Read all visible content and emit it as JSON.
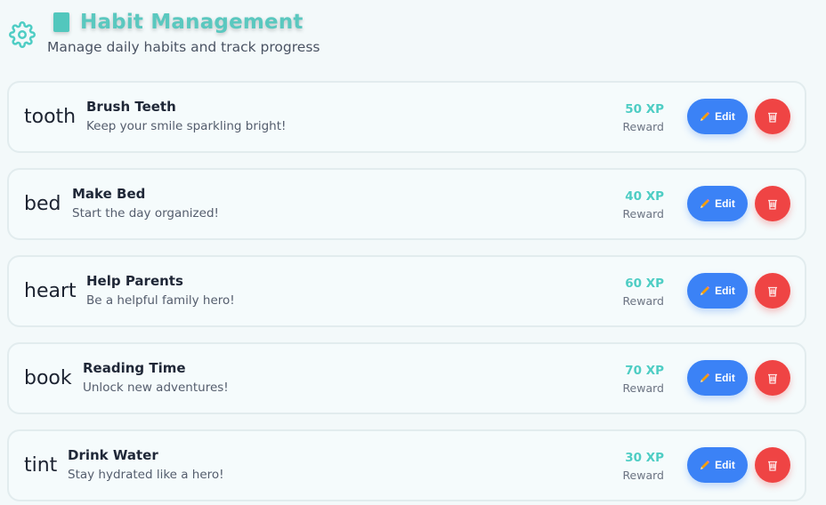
{
  "header": {
    "title": "Habit Management",
    "subtitle": "Manage daily habits and track progress",
    "settings_icon": "gear-icon",
    "title_icon": "clipboard-icon"
  },
  "colors": {
    "accent": "#4ecdc4",
    "edit": "#3b82f6",
    "delete": "#ef4444"
  },
  "habits": [
    {
      "icon": "tooth",
      "name": "Brush Teeth",
      "desc": "Keep your smile sparkling bright!",
      "xp": "50 XP",
      "xp_label": "Reward",
      "edit_label": "Edit"
    },
    {
      "icon": "bed",
      "name": "Make Bed",
      "desc": "Start the day organized!",
      "xp": "40 XP",
      "xp_label": "Reward",
      "edit_label": "Edit"
    },
    {
      "icon": "heart",
      "name": "Help Parents",
      "desc": "Be a helpful family hero!",
      "xp": "60 XP",
      "xp_label": "Reward",
      "edit_label": "Edit"
    },
    {
      "icon": "book",
      "name": "Reading Time",
      "desc": "Unlock new adventures!",
      "xp": "70 XP",
      "xp_label": "Reward",
      "edit_label": "Edit"
    },
    {
      "icon": "tint",
      "name": "Drink Water",
      "desc": "Stay hydrated like a hero!",
      "xp": "30 XP",
      "xp_label": "Reward",
      "edit_label": "Edit"
    }
  ]
}
